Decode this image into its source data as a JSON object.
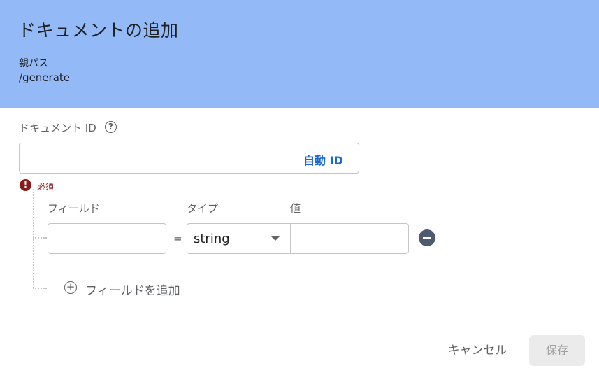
{
  "dialog": {
    "title": "ドキュメントの追加",
    "parent_label": "親パス",
    "parent_value": "/generate"
  },
  "doc_id": {
    "label": "ドキュメント ID",
    "help_glyph": "?",
    "auto_id_label": "自動 ID",
    "error_glyph": "!",
    "error_text": "必須"
  },
  "fields": {
    "columns": {
      "field": "フィールド",
      "type": "タイプ",
      "value": "値"
    },
    "equals": "=",
    "row": {
      "type_value": "string"
    },
    "add_label": "フィールドを追加",
    "add_glyph": "+"
  },
  "footer": {
    "cancel_label": "キャンセル",
    "save_label": "保存"
  },
  "colors": {
    "header_bg": "#93b9f7",
    "accent": "#1967d2",
    "error": "#8b1a1a"
  }
}
